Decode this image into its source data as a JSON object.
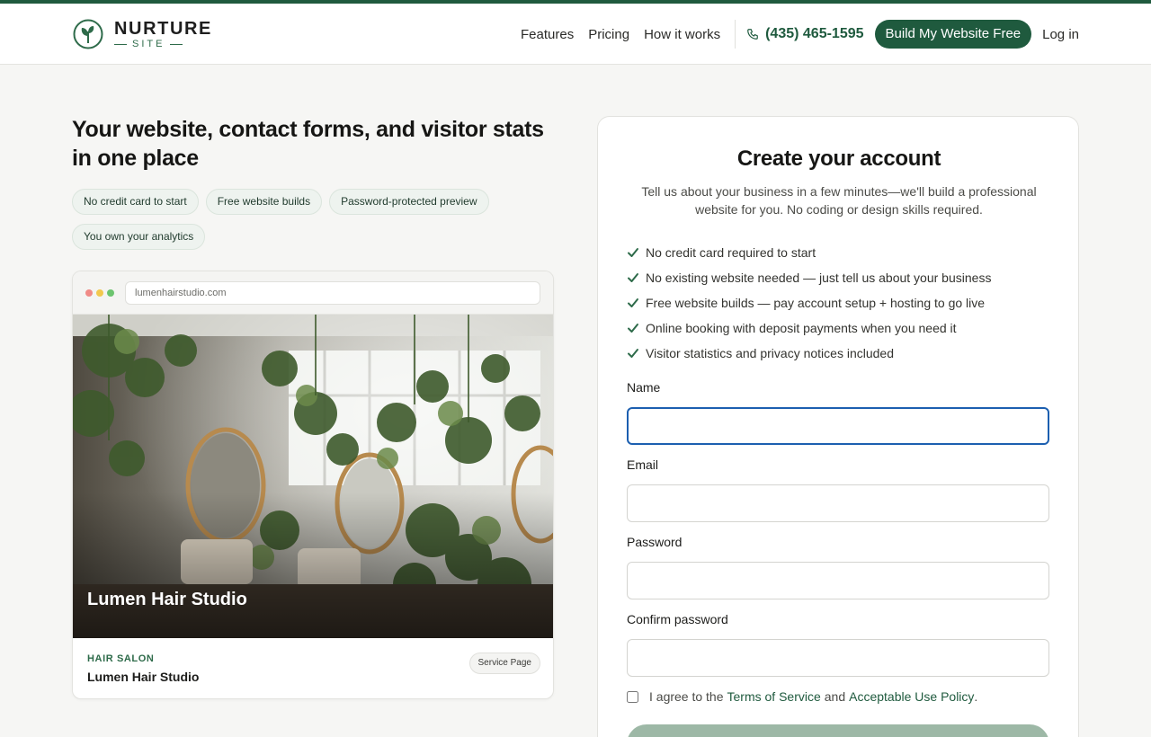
{
  "brand": {
    "name": "NURTURE",
    "sub": "SITE",
    "accent": "#1f5a3e"
  },
  "nav": {
    "links": [
      "Features",
      "Pricing",
      "How it works"
    ],
    "phone": "(435) 465-1595",
    "cta": "Build My Website Free",
    "login": "Log in"
  },
  "hero": {
    "title": "Your website, contact forms, and visitor stats in one place",
    "chips": [
      "No credit card to start",
      "Free website builds",
      "Password-protected preview",
      "You own your analytics"
    ]
  },
  "preview": {
    "url": "lumenhairstudio.com",
    "photo_title": "Lumen Hair Studio",
    "category": "HAIR SALON",
    "business_name": "Lumen Hair Studio",
    "badge": "Service Page",
    "dot_colors": [
      "#f08b86",
      "#f2c84e",
      "#6cc46f"
    ]
  },
  "form": {
    "title": "Create your account",
    "subtitle": "Tell us about your business in a few minutes—we'll build a professional website for you. No coding or design skills required.",
    "benefits": [
      "No credit card required to start",
      "No existing website needed — just tell us about your business",
      "Free website builds — pay account setup + hosting to go live",
      "Online booking with deposit payments when you need it",
      "Visitor statistics and privacy notices included"
    ],
    "fields": {
      "name_label": "Name",
      "email_label": "Email",
      "password_label": "Password",
      "confirm_label": "Confirm password"
    },
    "agree": {
      "prefix": "I agree to the",
      "terms": "Terms of Service",
      "and": "and",
      "policy": "Acceptable Use Policy",
      "suffix": "."
    }
  }
}
